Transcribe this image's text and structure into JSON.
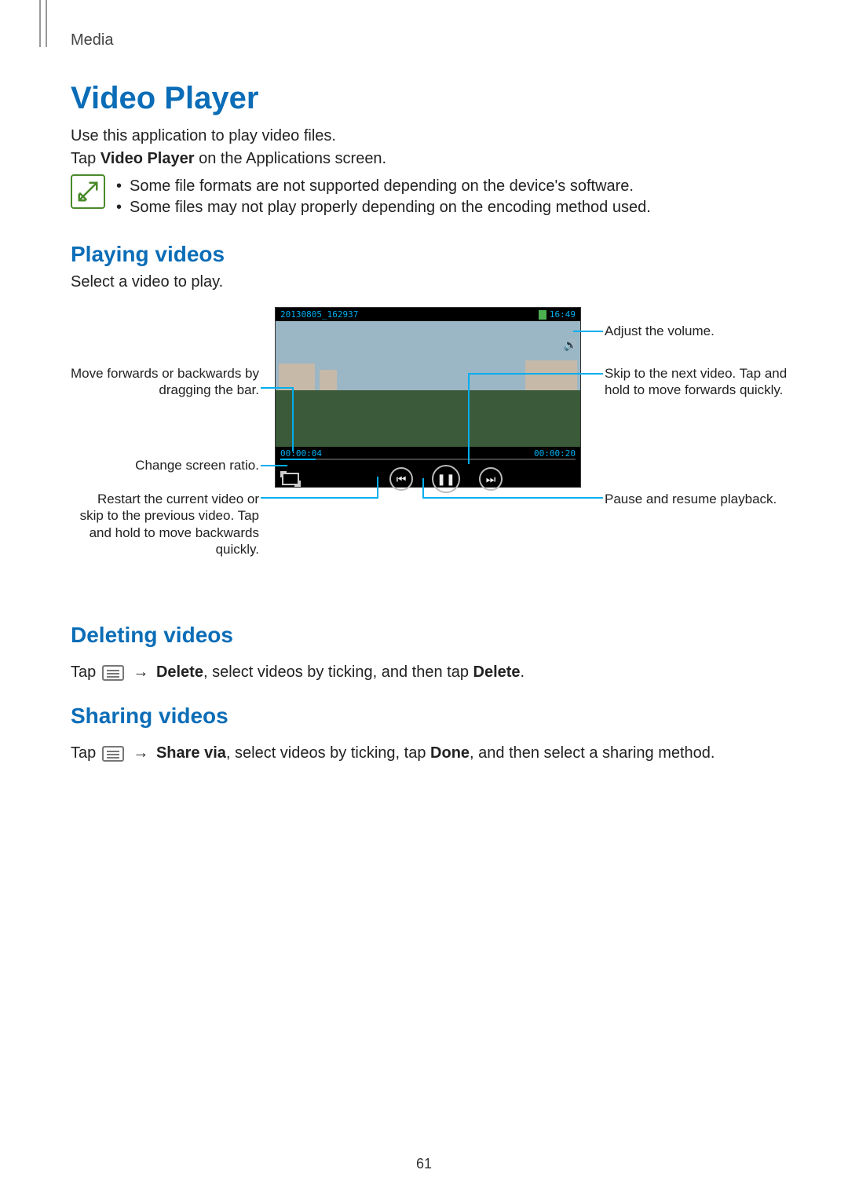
{
  "section": "Media",
  "title": "Video Player",
  "intro1": "Use this application to play video files.",
  "intro2_pre": "Tap ",
  "intro2_bold": "Video Player",
  "intro2_post": " on the Applications screen.",
  "note": {
    "items": [
      "Some file formats are not supported depending on the device's software.",
      "Some files may not play properly depending on the encoding method used."
    ]
  },
  "playing": {
    "heading": "Playing videos",
    "text": "Select a video to play."
  },
  "player": {
    "filename": "20130805_162937",
    "clock": "16:49",
    "elapsed": "00:00:04",
    "duration": "00:00:20"
  },
  "callouts": {
    "left_seek": "Move forwards or backwards by dragging the bar.",
    "left_ratio": "Change screen ratio.",
    "left_prev": "Restart the current video or skip to the previous video. Tap and hold to move backwards quickly.",
    "right_volume": "Adjust the volume.",
    "right_next": "Skip to the next video. Tap and hold to move forwards quickly.",
    "right_pause": "Pause and resume playback."
  },
  "deleting": {
    "heading": "Deleting videos",
    "pre": "Tap ",
    "arrow": "→",
    "bold1": "Delete",
    "mid": ", select videos by ticking, and then tap ",
    "bold2": "Delete",
    "post": "."
  },
  "sharing": {
    "heading": "Sharing videos",
    "pre": "Tap ",
    "arrow": "→",
    "bold1": "Share via",
    "mid": ", select videos by ticking, tap ",
    "bold2": "Done",
    "post": ", and then select a sharing method."
  },
  "page_number": "61"
}
